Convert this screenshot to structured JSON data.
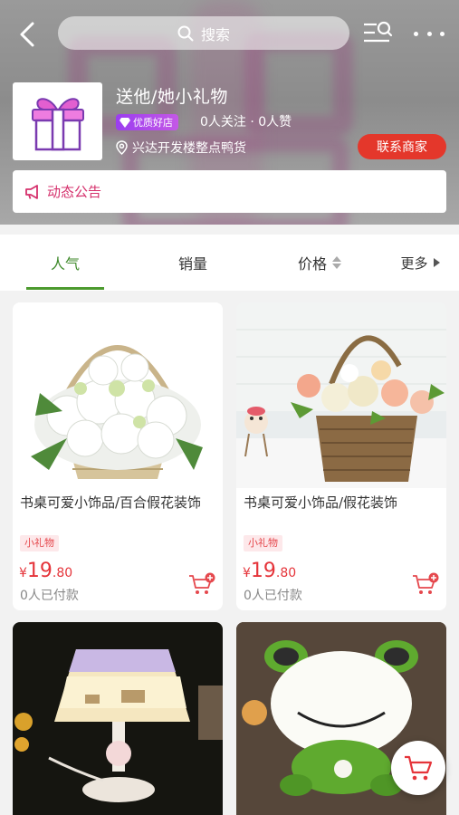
{
  "colors": {
    "accent_green": "#4c9a2e",
    "price_red": "#e5343a",
    "contact_red": "#e4372b",
    "notice_pink": "#d5306c",
    "badge_purple": "#9b3df0"
  },
  "header": {
    "back_icon": "chevron-left-icon",
    "search_placeholder": "搜索",
    "category_search_icon": "list-search-icon",
    "more_icon": "ellipsis-icon"
  },
  "store": {
    "logo_icon": "gift-icon",
    "name": "送他/她小礼物",
    "badge": "优质好店",
    "stats": "0人关注 · 0人赞",
    "location": "兴达开发楼整点鸭货",
    "contact_label": "联系商家",
    "notice_label": "动态公告"
  },
  "tabs": [
    {
      "label": "人气",
      "active": true
    },
    {
      "label": "销量",
      "active": false
    },
    {
      "label": "价格",
      "active": false
    },
    {
      "label": "更多",
      "active": false
    }
  ],
  "products": [
    {
      "title": "书桌可爱小饰品/百合假花装饰",
      "tag": "小礼物",
      "currency": "¥",
      "price_int": "19",
      "price_dec": ".80",
      "sold": "0人已付款",
      "image": "white-flower-basket"
    },
    {
      "title": "书桌可爱小饰品/假花装饰",
      "tag": "小礼物",
      "currency": "¥",
      "price_int": "19",
      "price_dec": ".80",
      "sold": "0人已付款",
      "image": "rose-flower-basket"
    },
    {
      "title": "",
      "image": "night-lamp"
    },
    {
      "title": "",
      "image": "frog-lamp"
    }
  ],
  "float_cart_icon": "shopping-cart-icon"
}
